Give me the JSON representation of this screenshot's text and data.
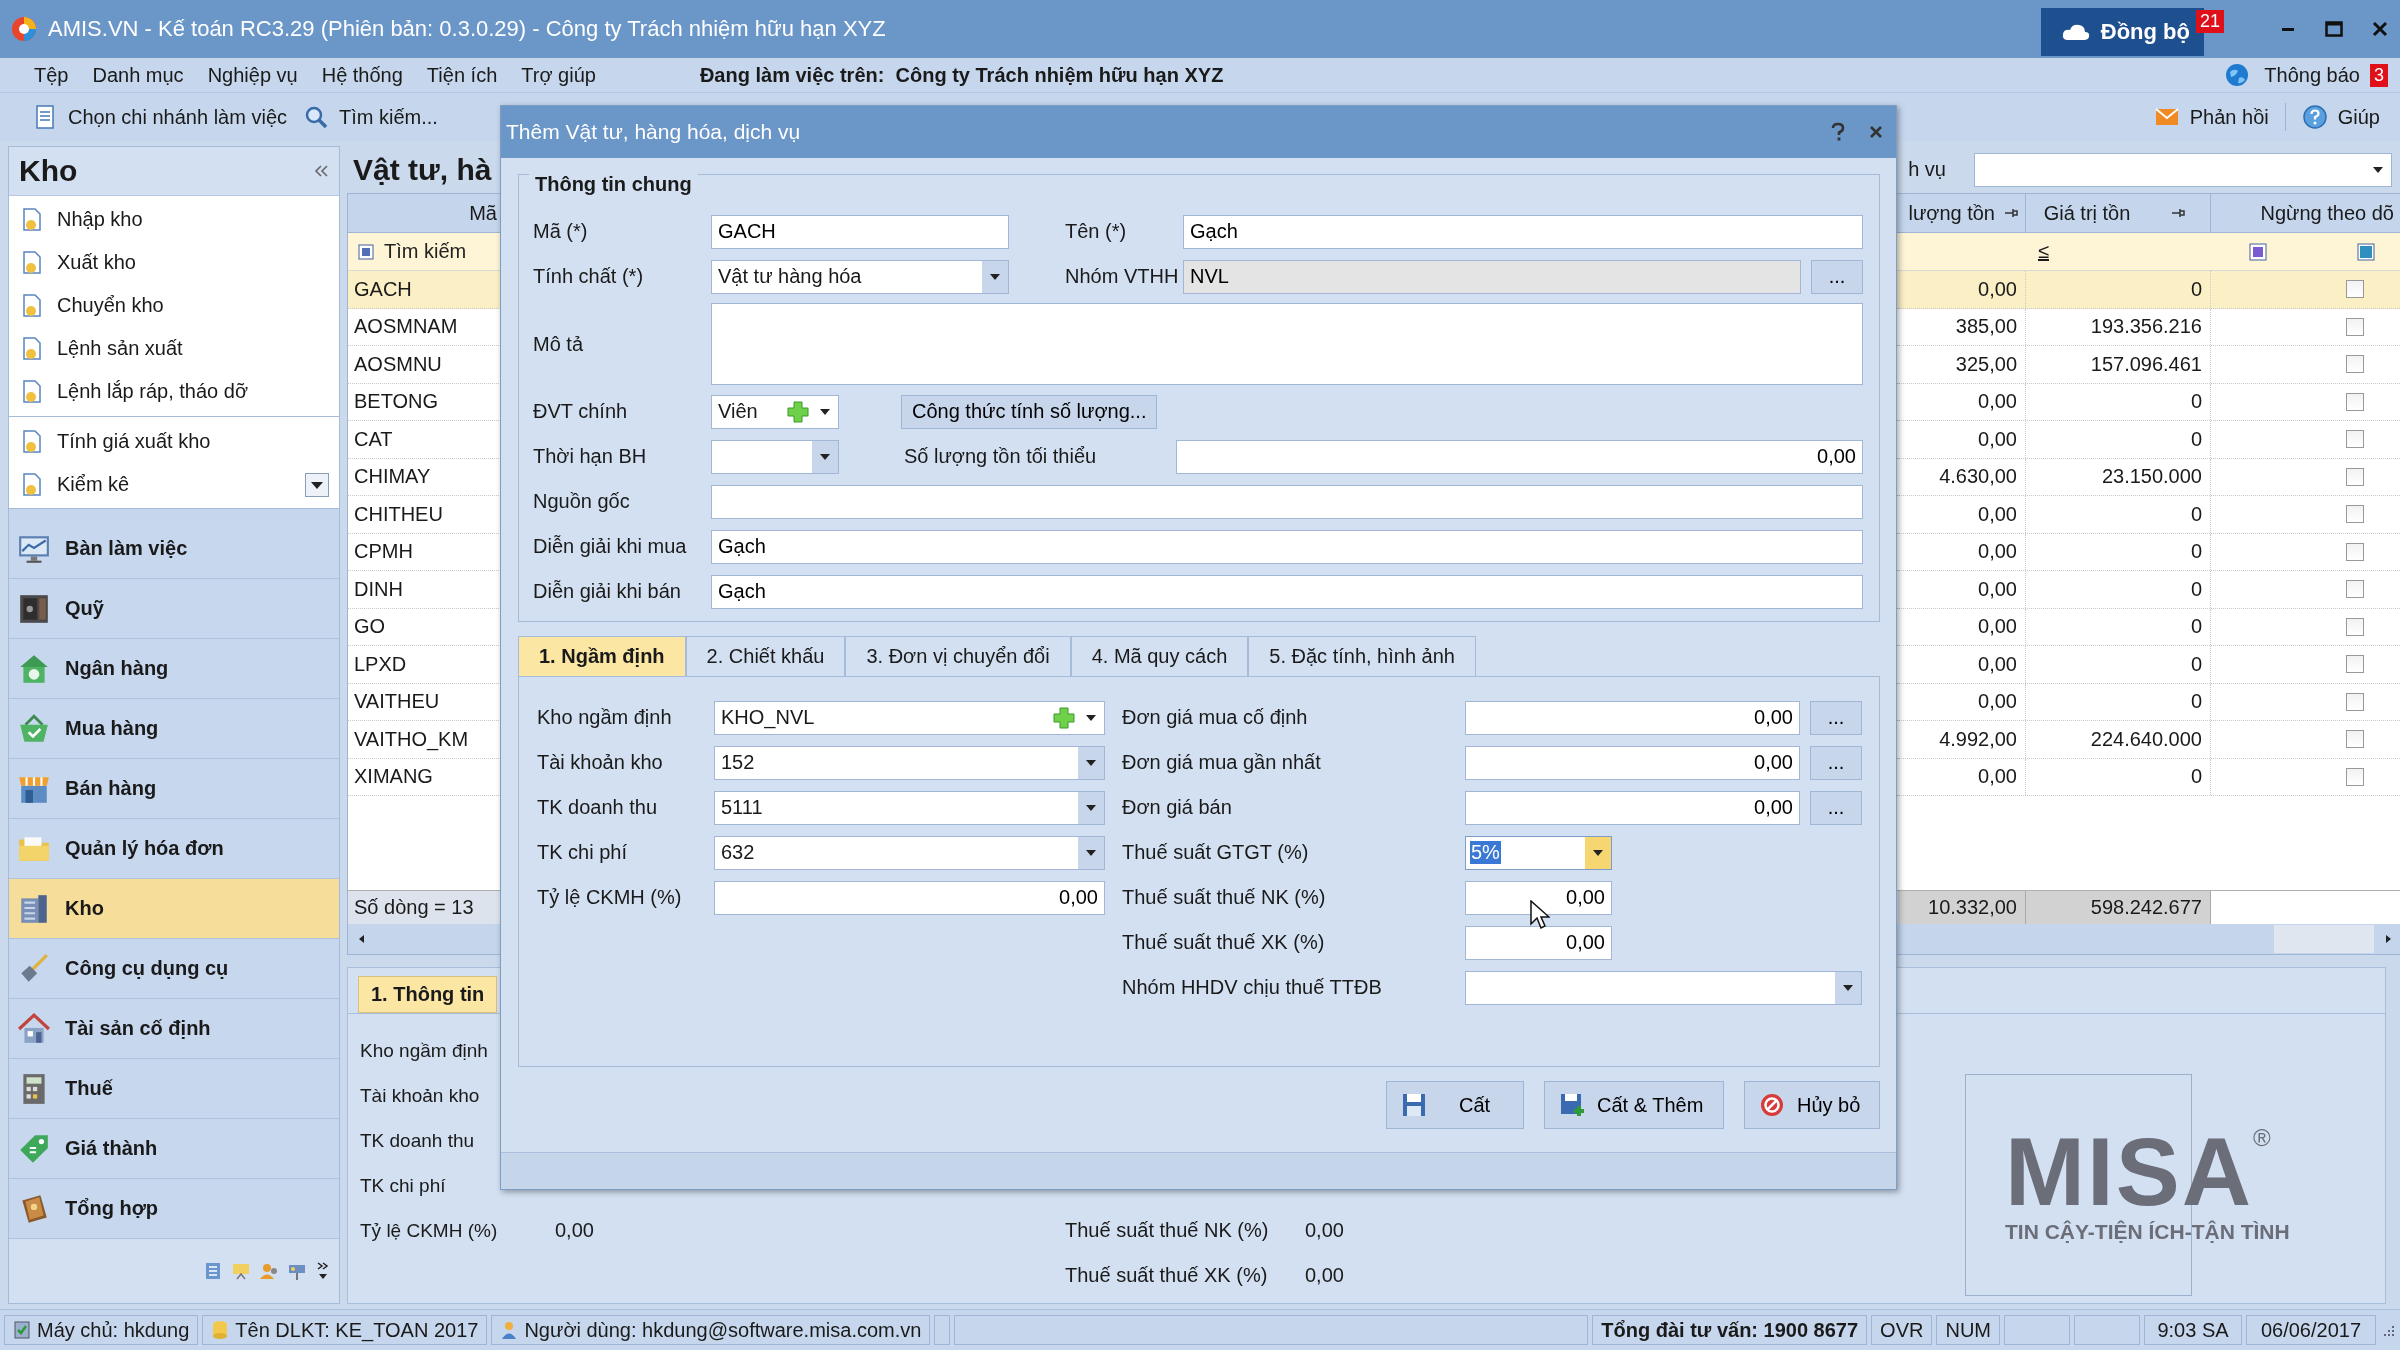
{
  "window": {
    "title": "AMIS.VN - Kế toán RC3.29 (Phiên bản: 0.3.0.29) - Công ty Trách nhiệm hữu hạn XYZ",
    "sync_button": "Đồng bộ",
    "sync_badge": "21"
  },
  "menu": {
    "items": [
      "Tệp",
      "Danh mục",
      "Nghiệp vụ",
      "Hệ thống",
      "Tiện ích",
      "Trợ giúp"
    ],
    "working_on": "Đang làm việc trên:",
    "company": "Công ty Trách nhiệm hữu hạn XYZ",
    "notifications": "Thông báo",
    "notifications_badge": "3"
  },
  "toolbar": {
    "left": [
      {
        "label": "Chọn chi nhánh làm việc",
        "kind": "branch"
      },
      {
        "label": "Tìm kiếm...",
        "kind": "search"
      }
    ],
    "right": [
      {
        "label": "Phản hồi",
        "kind": "feedback"
      },
      {
        "label": "Giúp",
        "kind": "help"
      }
    ]
  },
  "sidebar": {
    "title": "Kho",
    "tasks": [
      [
        "Nhập kho",
        "Xuất kho",
        "Chuyển kho",
        "Lệnh sản xuất",
        "Lệnh lắp ráp, tháo dỡ"
      ],
      [
        "Tính giá xuất kho",
        "Kiểm kê"
      ]
    ],
    "modules": [
      {
        "label": "Bàn làm việc",
        "kind": "monitor",
        "selected": false
      },
      {
        "label": "Quỹ",
        "kind": "safe",
        "selected": false
      },
      {
        "label": "Ngân hàng",
        "kind": "bank",
        "selected": false
      },
      {
        "label": "Mua hàng",
        "kind": "basket",
        "selected": false
      },
      {
        "label": "Bán hàng",
        "kind": "shop",
        "selected": false
      },
      {
        "label": "Quản lý hóa đơn",
        "kind": "folder",
        "selected": false
      },
      {
        "label": "Kho",
        "kind": "building",
        "selected": true
      },
      {
        "label": "Công cụ dụng cụ",
        "kind": "shovel",
        "selected": false
      },
      {
        "label": "Tài sản cố định",
        "kind": "house",
        "selected": false
      },
      {
        "label": "Thuế",
        "kind": "calculator",
        "selected": false
      },
      {
        "label": "Giá thành",
        "kind": "tag",
        "selected": false
      },
      {
        "label": "Tổng hợp",
        "kind": "book",
        "selected": false
      }
    ]
  },
  "list": {
    "title": "Vật tư, hà",
    "filter_label": "h vụ",
    "columns": [
      "Mã",
      "lượng tồn",
      "Giá trị tồn",
      "Ngừng theo dõ"
    ],
    "search_placeholder": "Tìm kiếm",
    "value_operator": "≤",
    "rows": [
      {
        "code": "GACH",
        "quantity": "0,00",
        "value": "0",
        "stopped": false,
        "selected": true
      },
      {
        "code": "AOSMNAM",
        "quantity": "385,00",
        "value": "193.356.216",
        "stopped": false,
        "selected": false
      },
      {
        "code": "AOSMNU",
        "quantity": "325,00",
        "value": "157.096.461",
        "stopped": false,
        "selected": false
      },
      {
        "code": "BETONG",
        "quantity": "0,00",
        "value": "0",
        "stopped": false,
        "selected": false
      },
      {
        "code": "CAT",
        "quantity": "0,00",
        "value": "0",
        "stopped": false,
        "selected": false
      },
      {
        "code": "CHIMAY",
        "quantity": "4.630,00",
        "value": "23.150.000",
        "stopped": false,
        "selected": false
      },
      {
        "code": "CHITHEU",
        "quantity": "0,00",
        "value": "0",
        "stopped": false,
        "selected": false
      },
      {
        "code": "CPMH",
        "quantity": "0,00",
        "value": "0",
        "stopped": false,
        "selected": false
      },
      {
        "code": "DINH",
        "quantity": "0,00",
        "value": "0",
        "stopped": false,
        "selected": false
      },
      {
        "code": "GO",
        "quantity": "0,00",
        "value": "0",
        "stopped": false,
        "selected": false
      },
      {
        "code": "LPXD",
        "quantity": "0,00",
        "value": "0",
        "stopped": false,
        "selected": false
      },
      {
        "code": "VAITHEU",
        "quantity": "0,00",
        "value": "0",
        "stopped": false,
        "selected": false
      },
      {
        "code": "VAITHO_KM",
        "quantity": "4.992,00",
        "value": "224.640.000",
        "stopped": false,
        "selected": false
      },
      {
        "code": "XIMANG",
        "quantity": "0,00",
        "value": "0",
        "stopped": false,
        "selected": false
      }
    ],
    "row_count": "Số dòng = 13",
    "total_quantity": "10.332,00",
    "total_value": "598.242.677"
  },
  "detail": {
    "tab": "1. Thông tin",
    "left": [
      {
        "label": "Kho ngầm định"
      },
      {
        "label": "Tài khoản kho"
      },
      {
        "label": "TK doanh thu"
      },
      {
        "label": "TK chi phí"
      },
      {
        "label": "Tỷ lệ CKMH (%)",
        "value": "0,00"
      }
    ],
    "right": [
      {
        "label": "Thuế suất thuế NK (%)",
        "value": "0,00"
      },
      {
        "label": "Thuế suất thuế XK (%)",
        "value": "0,00"
      }
    ],
    "logo": {
      "name": "MISA",
      "mark": "®",
      "tagline": "TIN CẬY-TIỆN ÍCH-TẬN TÌNH"
    }
  },
  "dialog": {
    "title": "Thêm Vật tư, hàng hóa, dịch vụ",
    "general": {
      "legend": "Thông tin chung",
      "code_label": "Mã (*)",
      "code": "GACH",
      "name_label": "Tên (*)",
      "name": "Gạch",
      "nature_label": "Tính chất (*)",
      "nature": "Vật tư hàng hóa",
      "group_label": "Nhóm VTHH",
      "group": "NVL",
      "group_button": "...",
      "description_label": "Mô tả",
      "unit_label": "ĐVT chính",
      "unit": "Viên",
      "formula_button": "Công thức tính số lượng...",
      "warranty_label": "Thời hạn BH",
      "min_stock_label": "Số lượng tồn tối thiểu",
      "min_stock": "0,00",
      "origin_label": "Nguồn gốc",
      "purchase_desc_label": "Diễn giải khi mua",
      "purchase_desc": "Gạch",
      "sale_desc_label": "Diễn giải khi bán",
      "sale_desc": "Gạch"
    },
    "tabs": [
      {
        "label": "1. Ngầm định",
        "selected": true
      },
      {
        "label": "2. Chiết khấu",
        "selected": false
      },
      {
        "label": "3. Đơn vị chuyển đổi",
        "selected": false
      },
      {
        "label": "4. Mã quy cách",
        "selected": false
      },
      {
        "label": "5. Đặc tính, hình ảnh",
        "selected": false
      }
    ],
    "left_fields": [
      {
        "label": "Kho ngầm định",
        "value": "KHO_NVL",
        "kind": "combo_add"
      },
      {
        "label": "Tài khoản kho",
        "value": "152",
        "kind": "combo"
      },
      {
        "label": "TK doanh thu",
        "value": "5111",
        "kind": "combo"
      },
      {
        "label": "TK chi phí",
        "value": "632",
        "kind": "combo"
      },
      {
        "label": "Tỷ lệ CKMH (%)",
        "value": "0,00",
        "kind": "number"
      }
    ],
    "right_fields": [
      {
        "label": "Đơn giá mua cố định",
        "value": "0,00",
        "button": "...",
        "kind": "price"
      },
      {
        "label": "Đơn giá mua gần nhất",
        "value": "0,00",
        "button": "...",
        "kind": "price"
      },
      {
        "label": "Đơn giá bán",
        "value": "0,00",
        "button": "...",
        "kind": "price"
      },
      {
        "label": "Thuế suất GTGT (%)",
        "value": "5%",
        "kind": "rate_combo"
      },
      {
        "label": "Thuế suất thuế NK (%)",
        "value": "0,00",
        "kind": "rate"
      },
      {
        "label": "Thuế suất thuế XK (%)",
        "value": "0,00",
        "kind": "rate"
      },
      {
        "label": "Nhóm HHDV chịu thuế TTĐB",
        "kind": "combo"
      }
    ],
    "buttons": [
      {
        "label": "Cất",
        "kind": "save"
      },
      {
        "label": "Cất & Thêm",
        "kind": "save_new"
      },
      {
        "label": "Hủy bỏ",
        "kind": "cancel"
      }
    ]
  },
  "status_bar": {
    "server": "Máy chủ: hkdung",
    "database": "Tên DLKT: KE_TOAN 2017",
    "user": "Người dùng: hkdung@software.misa.com.vn",
    "hotline": "Tổng đài tư vấn: 1900 8677",
    "mode_ovr": "OVR",
    "mode_num": "NUM",
    "time": "9:03 SA",
    "date": "06/06/2017"
  }
}
